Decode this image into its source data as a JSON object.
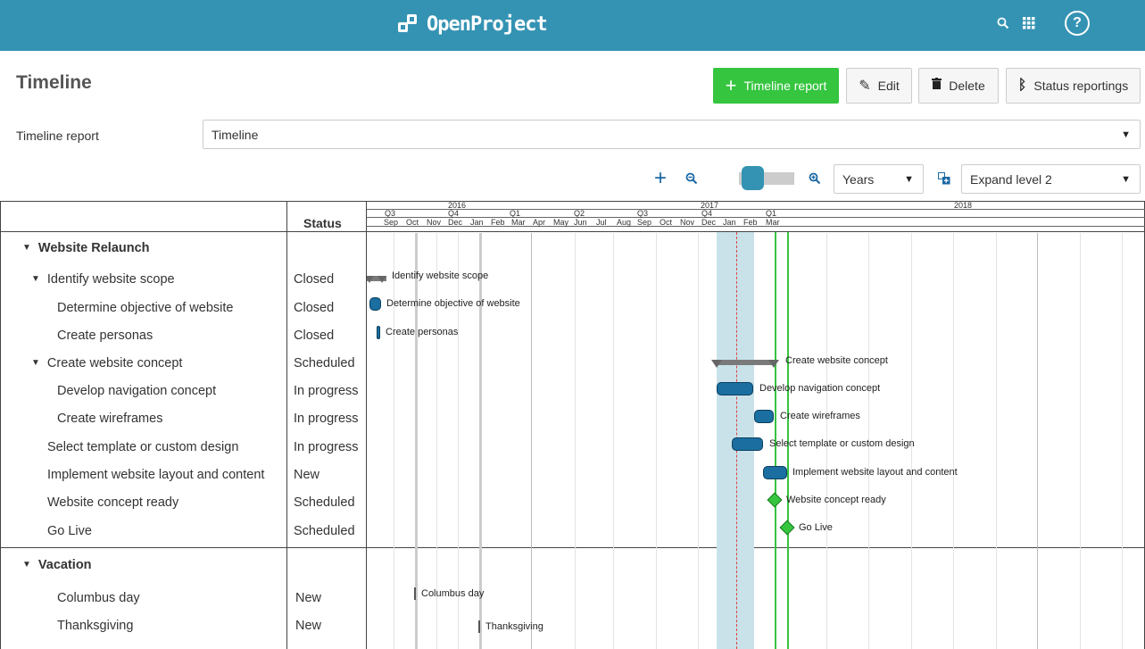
{
  "header": {
    "logo_text": "OpenProject",
    "search_icon": "search-icon",
    "modules_icon": "grid-icon",
    "help_icon": "?",
    "brand_color": "#3493b3"
  },
  "toolbar": {
    "title": "Timeline",
    "add_label": "Timeline report",
    "edit_label": "Edit",
    "delete_label": "Delete",
    "status_label": "Status reportings"
  },
  "report": {
    "label": "Timeline report",
    "value": "Timeline"
  },
  "zoom": {
    "scale_value": "Years",
    "level_value": "Expand level 2"
  },
  "columns": {
    "status_header": "Status"
  },
  "timeline_header": {
    "years": [
      "2016",
      "2017",
      "2018"
    ],
    "quarters": [
      "Q3",
      "Q4",
      "Q1",
      "Q2",
      "Q3",
      "Q4",
      "Q1"
    ],
    "months": [
      "Sep",
      "Oct",
      "Nov",
      "Dec",
      "Jan",
      "Feb",
      "Mar",
      "Apr",
      "May",
      "Jun",
      "Jul",
      "Aug",
      "Sep",
      "Oct",
      "Nov",
      "Dec",
      "Jan",
      "Feb",
      "Mar"
    ]
  },
  "rows": [
    {
      "name": "Website Relaunch",
      "status": "",
      "label": ""
    },
    {
      "name": "Identify website scope",
      "status": "Closed",
      "label": "Identify website scope"
    },
    {
      "name": "Determine objective of website",
      "status": "Closed",
      "label": "Determine objective of website"
    },
    {
      "name": "Create personas",
      "status": "Closed",
      "label": "Create personas"
    },
    {
      "name": "Create website concept",
      "status": "Scheduled",
      "label": "Create website concept"
    },
    {
      "name": "Develop navigation concept",
      "status": "In progress",
      "label": "Develop navigation concept"
    },
    {
      "name": "Create wireframes",
      "status": "In progress",
      "label": "Create wireframes"
    },
    {
      "name": "Select template or custom design",
      "status": "In progress",
      "label": "Select template or custom design"
    },
    {
      "name": "Implement website layout and content",
      "status": "New",
      "label": "Implement website layout and content"
    },
    {
      "name": "Website concept ready",
      "status": "Scheduled",
      "label": "Website concept ready"
    },
    {
      "name": "Go Live",
      "status": "Scheduled",
      "label": "Go Live"
    },
    {
      "name": "Vacation",
      "status": "",
      "label": ""
    },
    {
      "name": "Columbus day",
      "status": "New",
      "label": "Columbus day"
    },
    {
      "name": "Thanksgiving",
      "status": "New",
      "label": "Thanksgiving"
    }
  ]
}
